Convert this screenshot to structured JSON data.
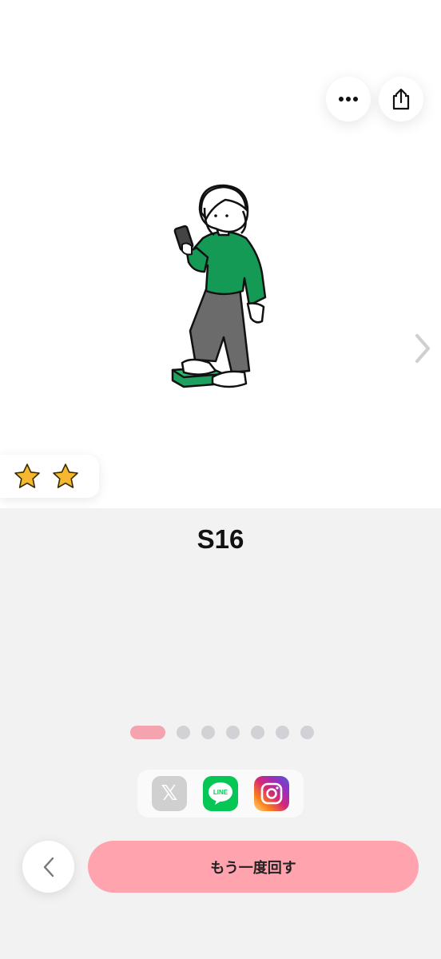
{
  "hero": {
    "illustration": "person-on-scale-illustration",
    "rating": {
      "stars": 2,
      "star_color": "#f5b82e"
    }
  },
  "toolbar": {
    "more_icon": "more-icon",
    "share_icon": "share-icon"
  },
  "result": {
    "code": "S16"
  },
  "pagination": {
    "total": 7,
    "current": 1,
    "active_color": "#f5a3ae"
  },
  "social": {
    "x_label": "𝕏",
    "line_label": "LINE",
    "icons": [
      "x-icon",
      "line-icon",
      "instagram-icon"
    ]
  },
  "actions": {
    "back_icon": "chevron-left-icon",
    "respin_label": "もう一度回す",
    "respin_color": "#ffa3ae"
  }
}
